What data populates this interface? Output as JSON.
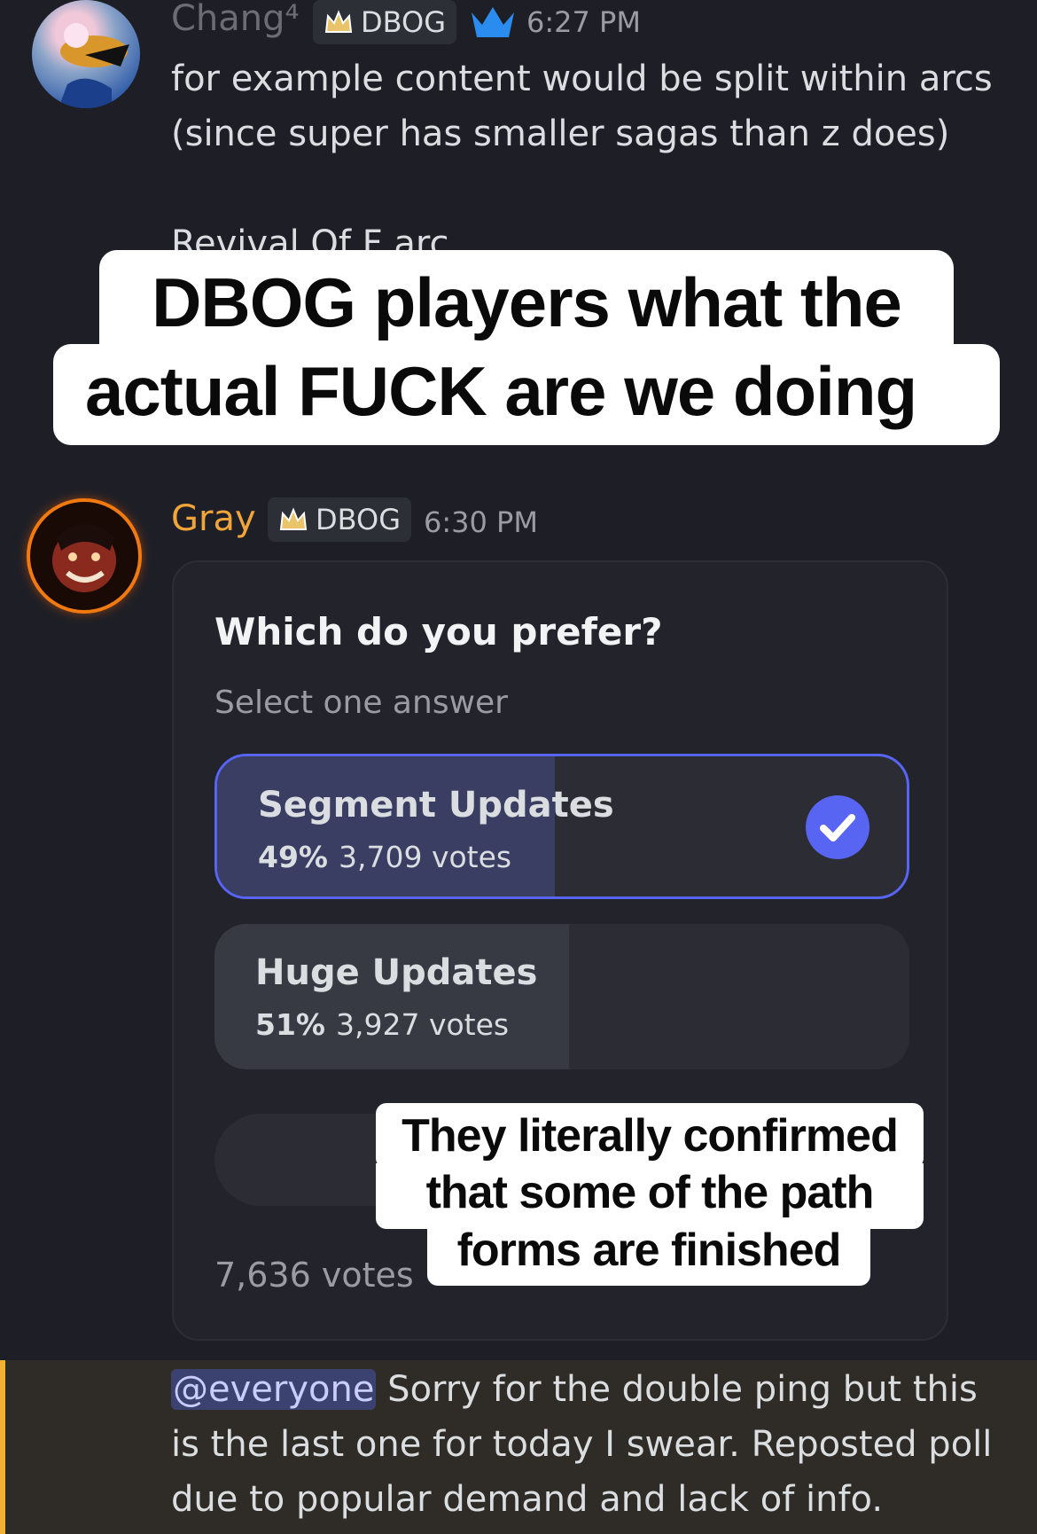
{
  "messages": [
    {
      "author": "Chang⁴",
      "tag": "DBOG",
      "time": "6:27 PM",
      "lines": [
        "for example content would be split within arcs",
        "(since super has smaller sagas than z does)"
      ],
      "partial_line": "Revival Of F arc"
    },
    {
      "author": "Gray",
      "tag": "DBOG",
      "time": "6:30 PM"
    }
  ],
  "poll": {
    "question": "Which do you prefer?",
    "instruction": "Select one answer",
    "options": [
      {
        "label": "Segment Updates",
        "percent": "49%",
        "votes": "3,709 votes",
        "share": 0.49,
        "selected": true
      },
      {
        "label": "Huge Updates",
        "percent": "51%",
        "votes": "3,927 votes",
        "share": 0.51,
        "selected": false
      }
    ],
    "total_votes": "7,636 votes",
    "separator": "•"
  },
  "followup": {
    "mention": "@everyone",
    "lines": [
      "Sorry for the double ping but this",
      "is the last one for today I swear. Reposted poll",
      "due to popular demand and lack of info."
    ]
  },
  "captions": {
    "top_line1": "DBOG players what the",
    "top_line2": "actual FUCK are we doing",
    "mid_line1": "They literally confirmed",
    "mid_line2": "that some of the path",
    "mid_line3": "forms are finished"
  },
  "colors": {
    "background": "#1e1f26",
    "accent": "#5865f2",
    "gray_name": "#f0a43a",
    "mention_bg": "#3c4270",
    "mention_text": "#c9cdfb",
    "highlight_bar": "#f0b232"
  }
}
